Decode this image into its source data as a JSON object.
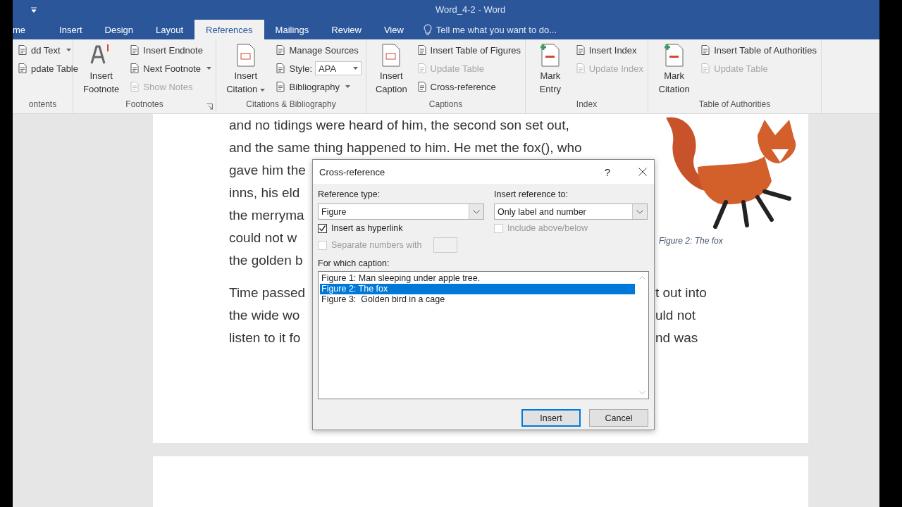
{
  "window": {
    "title": "Word_4-2 - Word"
  },
  "tabs": [
    {
      "label": "me",
      "selected": false
    },
    {
      "label": "Insert",
      "selected": false
    },
    {
      "label": "Design",
      "selected": false
    },
    {
      "label": "Layout",
      "selected": false
    },
    {
      "label": "References",
      "selected": true
    },
    {
      "label": "Mailings",
      "selected": false
    },
    {
      "label": "Review",
      "selected": false
    },
    {
      "label": "View",
      "selected": false
    }
  ],
  "tell_me": {
    "placeholder": "Tell me what you want to do..."
  },
  "ribbon": {
    "groups": [
      {
        "label": "ontents",
        "launcher": false,
        "items": [
          {
            "kind": "small",
            "label": "dd Text",
            "disabled": false,
            "dropdown": true
          },
          {
            "kind": "small",
            "label": "pdate Table",
            "disabled": false,
            "dropdown": false
          }
        ]
      },
      {
        "label": "Footnotes",
        "launcher": true,
        "items": [
          {
            "kind": "large",
            "label": "Insert Footnote",
            "dropdown": false
          },
          {
            "kind": "small",
            "label": "Insert Endnote",
            "disabled": false,
            "dropdown": false
          },
          {
            "kind": "small",
            "label": "Next Footnote",
            "disabled": false,
            "dropdown": true
          },
          {
            "kind": "small",
            "label": "Show Notes",
            "disabled": true,
            "dropdown": false
          }
        ]
      },
      {
        "label": "Citations & Bibliography",
        "launcher": false,
        "items": [
          {
            "kind": "large",
            "label": "Insert Citation",
            "dropdown": true
          },
          {
            "kind": "small",
            "label": "Manage Sources",
            "disabled": false,
            "dropdown": false
          },
          {
            "kind": "combo",
            "label": "Style:",
            "value": "APA"
          },
          {
            "kind": "small",
            "label": "Bibliography",
            "disabled": false,
            "dropdown": true
          }
        ]
      },
      {
        "label": "Captions",
        "launcher": false,
        "items": [
          {
            "kind": "large",
            "label": "Insert Caption",
            "dropdown": false
          },
          {
            "kind": "small",
            "label": "Insert Table of Figures",
            "disabled": false,
            "dropdown": false
          },
          {
            "kind": "small",
            "label": "Update Table",
            "disabled": true,
            "dropdown": false
          },
          {
            "kind": "small",
            "label": "Cross-reference",
            "disabled": false,
            "dropdown": false
          }
        ]
      },
      {
        "label": "Index",
        "launcher": false,
        "items": [
          {
            "kind": "large",
            "label": "Mark Entry",
            "dropdown": false
          },
          {
            "kind": "small",
            "label": "Insert Index",
            "disabled": false,
            "dropdown": false
          },
          {
            "kind": "small",
            "label": "Update Index",
            "disabled": true,
            "dropdown": false
          }
        ]
      },
      {
        "label": "Table of Authorities",
        "launcher": false,
        "items": [
          {
            "kind": "large",
            "label": "Mark Citation",
            "dropdown": false
          },
          {
            "kind": "small",
            "label": "Insert Table of Authorities",
            "disabled": false,
            "dropdown": false
          },
          {
            "kind": "small",
            "label": "Update Table",
            "disabled": true,
            "dropdown": false
          }
        ]
      }
    ]
  },
  "document": {
    "paragraphs": [
      {
        "lines": [
          {
            "left": "and no tidings were heard of him, the second son set out,"
          },
          {
            "left": "and the same thing happened to him. He met the fox(), who"
          },
          {
            "left": "gave him the"
          },
          {
            "left": "inns, his eld"
          },
          {
            "left": "the merryma"
          },
          {
            "left": "could not w"
          },
          {
            "left": "the golden b"
          }
        ]
      },
      {
        "lines": [
          {
            "left": "Time passed",
            "right": "t out into"
          },
          {
            "left": "the wide wo",
            "right": "uld not"
          },
          {
            "left": "listen to it fo",
            "right": "nd was"
          }
        ]
      }
    ],
    "figure": {
      "caption": "Figure 2: The fox"
    }
  },
  "dialog": {
    "title": "Cross-reference",
    "help": "?",
    "reference_type": {
      "label": "Reference type:",
      "value": "Figure"
    },
    "insert_reference_to": {
      "label": "Insert reference to:",
      "value": "Only label and number"
    },
    "checkboxes": [
      {
        "label": "Insert as hyperlink",
        "checked": true,
        "disabled": false
      },
      {
        "label": "Include above/below",
        "checked": false,
        "disabled": true
      },
      {
        "label": "Separate numbers with",
        "checked": false,
        "disabled": true
      }
    ],
    "caption_list": {
      "label": "For which caption:",
      "items": [
        {
          "text": "Figure 1: Man sleeping under apple tree.",
          "selected": false
        },
        {
          "text": "Figure 2: The fox",
          "selected": true
        },
        {
          "text": "Figure 3:  Golden bird in a cage",
          "selected": false
        }
      ]
    },
    "buttons": [
      {
        "label": "Insert",
        "default": true
      },
      {
        "label": "Cancel",
        "default": false
      }
    ]
  }
}
